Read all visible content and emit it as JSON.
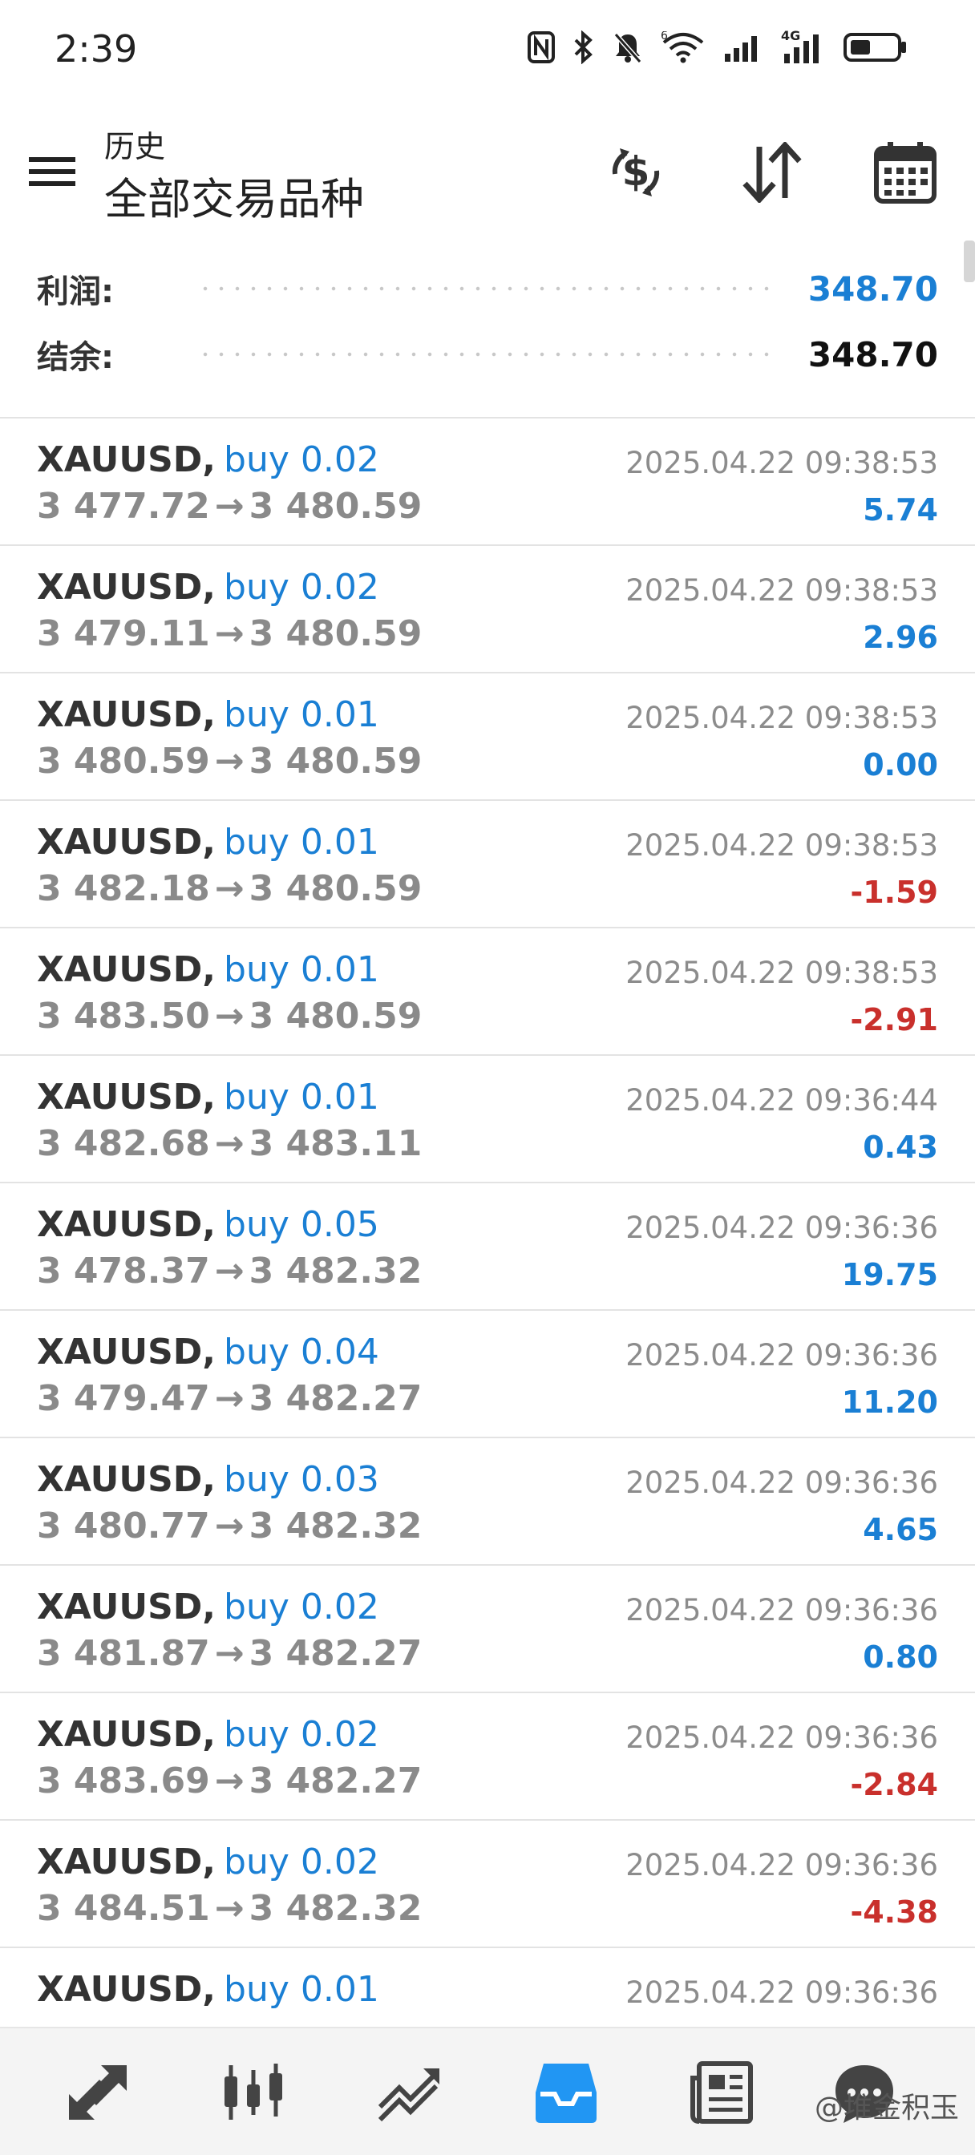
{
  "status_bar": {
    "time": "2:39",
    "network": "4G",
    "wifi_badge": "6"
  },
  "header": {
    "subtitle": "历史",
    "title": "全部交易品种",
    "icons": [
      "menu-icon",
      "currency-exchange-icon",
      "sort-icon",
      "calendar-icon"
    ]
  },
  "summary": {
    "profit_label": "利润:",
    "profit_value": "348.70",
    "balance_label": "结余:",
    "balance_value": "348.70"
  },
  "colors": {
    "positive": "#1a7fd4",
    "negative": "#c9302c",
    "nav_active": "#2196f3"
  },
  "trades": [
    {
      "symbol": "XAUUSD,",
      "action": "buy 0.02",
      "open": "3 477.72",
      "close": "3 480.59",
      "time": "2025.04.22 09:38:53",
      "profit": "5.74",
      "sign": "pos"
    },
    {
      "symbol": "XAUUSD,",
      "action": "buy 0.02",
      "open": "3 479.11",
      "close": "3 480.59",
      "time": "2025.04.22 09:38:53",
      "profit": "2.96",
      "sign": "pos"
    },
    {
      "symbol": "XAUUSD,",
      "action": "buy 0.01",
      "open": "3 480.59",
      "close": "3 480.59",
      "time": "2025.04.22 09:38:53",
      "profit": "0.00",
      "sign": "pos"
    },
    {
      "symbol": "XAUUSD,",
      "action": "buy 0.01",
      "open": "3 482.18",
      "close": "3 480.59",
      "time": "2025.04.22 09:38:53",
      "profit": "-1.59",
      "sign": "neg"
    },
    {
      "symbol": "XAUUSD,",
      "action": "buy 0.01",
      "open": "3 483.50",
      "close": "3 480.59",
      "time": "2025.04.22 09:38:53",
      "profit": "-2.91",
      "sign": "neg"
    },
    {
      "symbol": "XAUUSD,",
      "action": "buy 0.01",
      "open": "3 482.68",
      "close": "3 483.11",
      "time": "2025.04.22 09:36:44",
      "profit": "0.43",
      "sign": "pos"
    },
    {
      "symbol": "XAUUSD,",
      "action": "buy 0.05",
      "open": "3 478.37",
      "close": "3 482.32",
      "time": "2025.04.22 09:36:36",
      "profit": "19.75",
      "sign": "pos"
    },
    {
      "symbol": "XAUUSD,",
      "action": "buy 0.04",
      "open": "3 479.47",
      "close": "3 482.27",
      "time": "2025.04.22 09:36:36",
      "profit": "11.20",
      "sign": "pos"
    },
    {
      "symbol": "XAUUSD,",
      "action": "buy 0.03",
      "open": "3 480.77",
      "close": "3 482.32",
      "time": "2025.04.22 09:36:36",
      "profit": "4.65",
      "sign": "pos"
    },
    {
      "symbol": "XAUUSD,",
      "action": "buy 0.02",
      "open": "3 481.87",
      "close": "3 482.27",
      "time": "2025.04.22 09:36:36",
      "profit": "0.80",
      "sign": "pos"
    },
    {
      "symbol": "XAUUSD,",
      "action": "buy 0.02",
      "open": "3 483.69",
      "close": "3 482.27",
      "time": "2025.04.22 09:36:36",
      "profit": "-2.84",
      "sign": "neg"
    },
    {
      "symbol": "XAUUSD,",
      "action": "buy 0.02",
      "open": "3 484.51",
      "close": "3 482.32",
      "time": "2025.04.22 09:36:36",
      "profit": "-4.38",
      "sign": "neg"
    },
    {
      "symbol": "XAUUSD,",
      "action": "buy 0.01",
      "open": "",
      "close": "",
      "time": "2025.04.22 09:36:36",
      "profit": "",
      "sign": "pos"
    }
  ],
  "bottom_nav": {
    "items": [
      "quotes-icon",
      "chart-icon",
      "trade-icon",
      "history-icon",
      "news-icon",
      "chat-icon"
    ],
    "active": "history-icon",
    "watermark": "@堆金积玉"
  }
}
